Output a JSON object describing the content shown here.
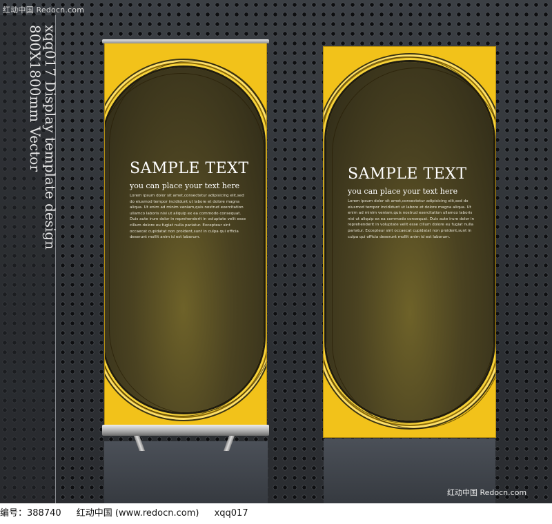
{
  "watermark": {
    "top_left": "红动中国  Redocn.com",
    "bottom_right": "红动中国 Redocn.com"
  },
  "side_title": {
    "line1": "xqq017 Display template design",
    "line2": "800X1800mm Vector"
  },
  "banners": [
    {
      "headline": "SAMPLE TEXT",
      "subhead": "you can place your text here",
      "body": "Lorem ipsum dolor sit amet,consectetur adipisicing elit,sed do eiusmod tempor incididunt ut labore et dolore magna aliqua. Ut enim ad minim veniam,quis nostrud exercitation ullamco laboris nisi ut aliquip ex ea commodo consequat. Duis aute irure dolor in reprehenderit in voluptate velit esse cillum dolore eu fugiat nulla pariatur. Excepteur sint occaecat cupidatat non proident,sunt in culpa qui officia deserunt mollit anim id est laborum."
    },
    {
      "headline": "SAMPLE TEXT",
      "subhead": "you can place your text here",
      "body": "Lorem ipsum dolor sit amet,consectetur adipisicing elit,sed do eiusmod tempor incididunt ut labore et dolore magna aliqua. Ut enim ad minim veniam,quis nostrud exercitation ullamco laboris nisi ut aliquip ex ea commodo consequat. Duis aute irure dolor in reprehenderit in voluptate velit esse cillum dolore eu fugiat nulla pariatur. Excepteur sint occaecat cupidatat non proident,sunt in culpa qui officia deserunt mollit anim id est laborum."
    }
  ],
  "footer": {
    "id_label": "编号：388740",
    "site": "红动中国 (www.redocn.com)",
    "code": "xqq017"
  },
  "colors": {
    "banner_yellow": "#f2c21a",
    "oval_brown": "#4a4221",
    "background": "#2f3236"
  }
}
